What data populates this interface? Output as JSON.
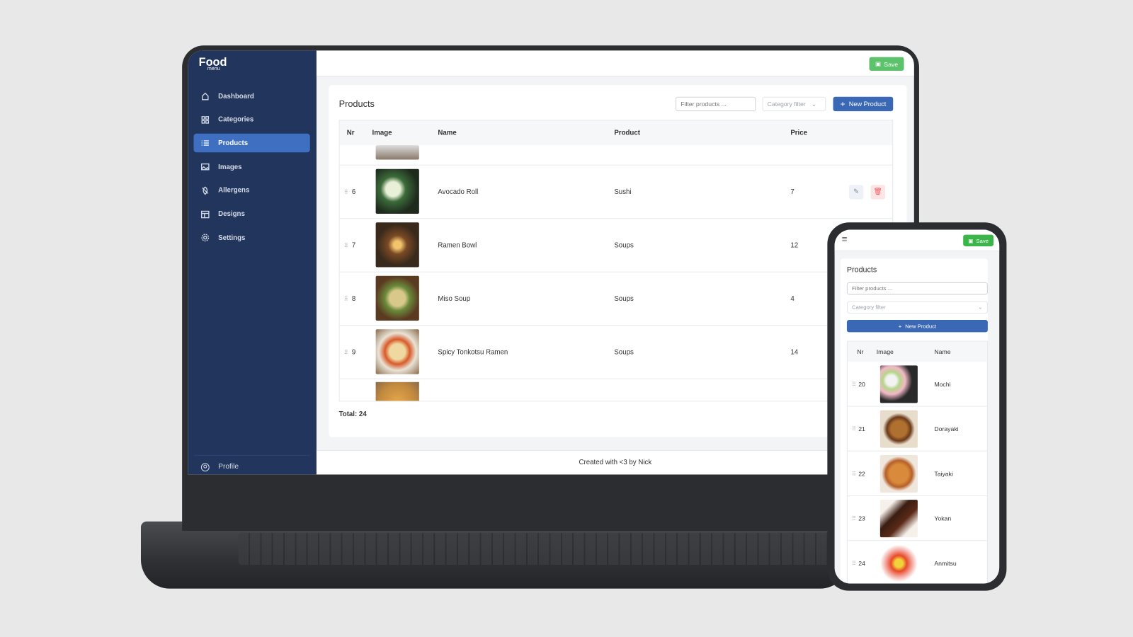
{
  "app": {
    "logo": "Food",
    "logo_sub": "menu",
    "save_label": "Save",
    "footer": "Created with <3 by Nick"
  },
  "sidebar": {
    "items": [
      {
        "label": "Dashboard",
        "icon": "home-icon"
      },
      {
        "label": "Categories",
        "icon": "grid-icon"
      },
      {
        "label": "Products",
        "icon": "list-icon",
        "active": true
      },
      {
        "label": "Images",
        "icon": "image-icon"
      },
      {
        "label": "Allergens",
        "icon": "allergen-icon"
      },
      {
        "label": "Designs",
        "icon": "layout-icon"
      },
      {
        "label": "Settings",
        "icon": "gear-icon"
      }
    ],
    "profile": "Profile"
  },
  "products": {
    "title": "Products",
    "filter_placeholder": "Filter products ...",
    "category_filter": "Category filter",
    "new_label": "New Product",
    "total": "Total: 24",
    "columns": [
      "Nr",
      "Image",
      "Name",
      "Product",
      "Price"
    ],
    "rows": [
      {
        "nr": "6",
        "name": "Avocado Roll",
        "product": "Sushi",
        "price": "7"
      },
      {
        "nr": "7",
        "name": "Ramen Bowl",
        "product": "Soups",
        "price": "12"
      },
      {
        "nr": "8",
        "name": "Miso Soup",
        "product": "Soups",
        "price": "4"
      },
      {
        "nr": "9",
        "name": "Spicy Tonkotsu Ramen",
        "product": "Soups",
        "price": "14"
      }
    ]
  },
  "mobile": {
    "columns": [
      "Nr",
      "Image",
      "Name"
    ],
    "rows": [
      {
        "nr": "20",
        "name": "Mochi"
      },
      {
        "nr": "21",
        "name": "Dorayaki"
      },
      {
        "nr": "22",
        "name": "Taiyaki"
      },
      {
        "nr": "23",
        "name": "Yokan"
      },
      {
        "nr": "24",
        "name": "Anmitsu"
      }
    ]
  },
  "colors": {
    "sidebar": "#22355c",
    "accent": "#3b68b5",
    "save": "#5cc26b",
    "danger": "#f05a5a"
  }
}
